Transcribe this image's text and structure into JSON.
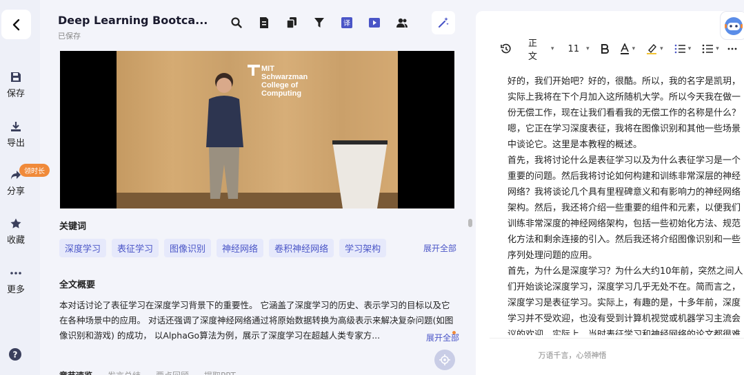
{
  "rail": {
    "items": [
      {
        "label": "保存",
        "icon": "save-icon"
      },
      {
        "label": "导出",
        "icon": "download-icon"
      },
      {
        "label": "分享",
        "icon": "share-icon"
      },
      {
        "label": "收藏",
        "icon": "star-icon"
      },
      {
        "label": "更多",
        "icon": "more-icon"
      }
    ],
    "badge": "领时长"
  },
  "header": {
    "title": "Deep Learning Bootca...",
    "status": "已保存"
  },
  "video": {
    "logo_line1": "MIT",
    "logo_line2": "Schwarzman",
    "logo_line3": "College of",
    "logo_line4": "Computing"
  },
  "keywords": {
    "title": "关键词",
    "items": [
      "深度学习",
      "表征学习",
      "图像识别",
      "神经网络",
      "卷积神经网络",
      "学习架构"
    ],
    "expand": "展开全部"
  },
  "summary": {
    "title": "全文概要",
    "text": "本对话讨论了表征学习在深度学习背景下的重要性。 它涵盖了深度学习的历史、表示学习的目标以及它在各种场景中的应用。 对话还强调了深度神经网络通过将原始数据转换为高级表示来解决复杂问题(如图像识别和游戏) 的成功， 以AlphaGo算法为例，展示了深度学习在超越人类专家方...",
    "expand": "展开全部"
  },
  "bottom_tabs": [
    "章节速览",
    "发言总结",
    "要点回顾",
    "提取PPT"
  ],
  "editor": {
    "style": "正文",
    "font_size": "11",
    "lines": [
      "好的，我们开始吧？好的，很酷。所以，我的名字是凯玥，",
      "实际上我将在下个月加入这所随机大学。所以今天我在做一",
      "份无偿工作，现在让我们看看我的无偿工作的名称是什么？",
      "嗯，它正在学习深度表征，我将在图像识别和其他一些场景",
      "中谈论它。这里是本教程的概述。",
      "首先，我将讨论什么是表征学习以及为什么表征学习是一个",
      "重要的问题。然后我将讨论如何构建和训练非常深层的神经",
      "网络？我将谈论几个具有里程碑意义和有影响力的神经网络",
      "架构。然后，我还将介绍一些重要的组件和元素，以便我们",
      "训练非常深度的神经网络架构，包括一些初始化方法、规范",
      "化方法和剩余连接的引入。然后我还将介绍图像识别和一些",
      "序列处理问题的应用。",
      "首先，为什么是深度学习？为什么大约10年前，突然之间人",
      "们开始谈论深度学习，深度学习几乎无处不在。简而言之，",
      "深度学习是表征学习。实际上，有趣的是，十多年前，深度",
      "学习并不受欢迎，也没有受到计算机视觉或机器学习主流会",
      "议的欢迎。实际上，当时表征学习和神经网络的论文都很难"
    ],
    "footer": "万语千言，心领神悟"
  }
}
